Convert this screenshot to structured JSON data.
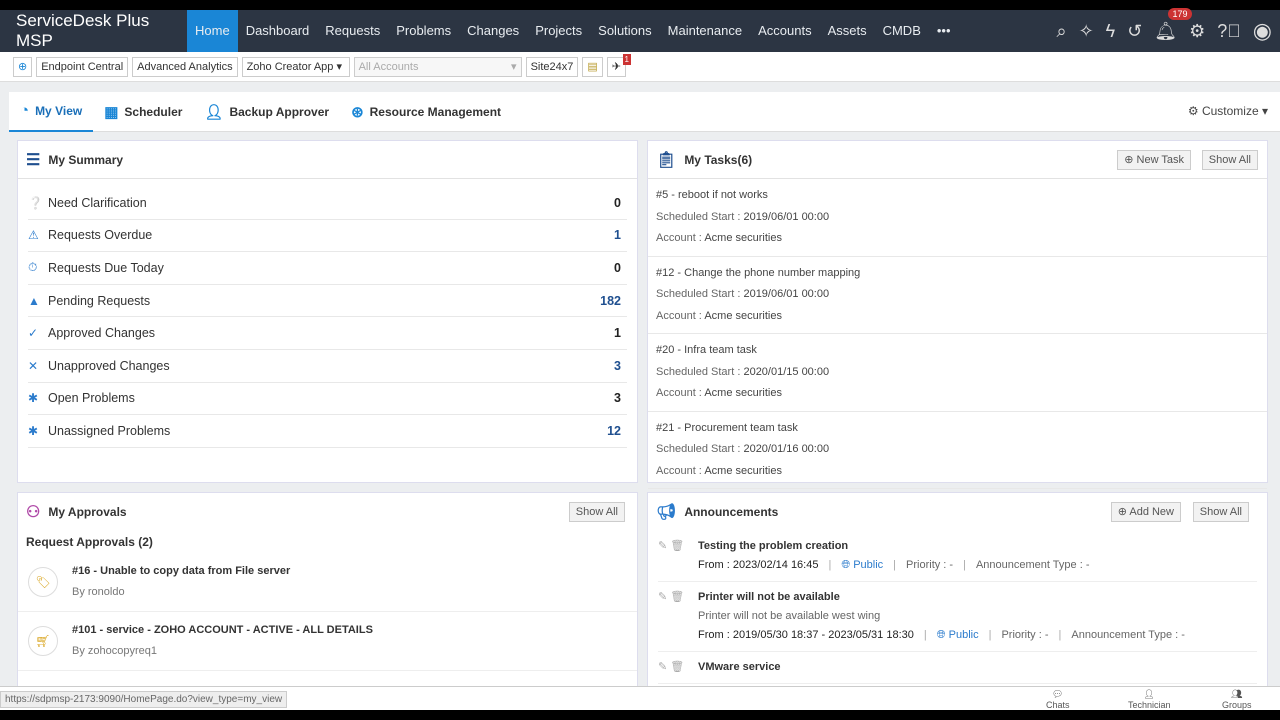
{
  "app": {
    "title": "ServiceDesk Plus MSP"
  },
  "nav": {
    "items": [
      "Home",
      "Dashboard",
      "Requests",
      "Problems",
      "Changes",
      "Projects",
      "Solutions",
      "Maintenance",
      "Accounts",
      "Assets",
      "CMDB"
    ],
    "more": "•••",
    "notif_count": "179"
  },
  "toolbar": {
    "endpoint": "Endpoint Central",
    "analytics": "Advanced Analytics",
    "zoho": "Zoho Creator App",
    "accounts_placeholder": "All Accounts",
    "site": "Site24x7",
    "rocket_badge": "1"
  },
  "tabs": [
    "My View",
    "Scheduler",
    "Backup Approver",
    "Resource Management"
  ],
  "customize": "Customize",
  "summary": {
    "title": "My Summary",
    "rows": [
      {
        "label": "Need Clarification",
        "value": "0"
      },
      {
        "label": "Requests Overdue",
        "value": "1"
      },
      {
        "label": "Requests Due Today",
        "value": "0"
      },
      {
        "label": "Pending Requests",
        "value": "182"
      },
      {
        "label": "Approved Changes",
        "value": "1"
      },
      {
        "label": "Unapproved Changes",
        "value": "3"
      },
      {
        "label": "Open Problems",
        "value": "3"
      },
      {
        "label": "Unassigned Problems",
        "value": "12"
      }
    ]
  },
  "tasks": {
    "title": "My Tasks(6)",
    "new_task": "New Task",
    "show_all": "Show All",
    "sched_label": "Scheduled Start :",
    "account_label": "Account :",
    "items": [
      {
        "title": "#5 - reboot if not works",
        "start": "2019/06/01 00:00",
        "account": "Acme securities"
      },
      {
        "title": "#12 - Change the phone number mapping",
        "start": "2019/06/01 00:00",
        "account": "Acme securities"
      },
      {
        "title": "#20 - Infra team task",
        "start": "2020/01/15 00:00",
        "account": "Acme securities"
      },
      {
        "title": "#21 - Procurement team task",
        "start": "2020/01/16 00:00",
        "account": "Acme securities"
      }
    ]
  },
  "approvals": {
    "title": "My Approvals",
    "show_all": "Show All",
    "subtitle": "Request Approvals (2)",
    "items": [
      {
        "title": "#16 - Unable to copy data from File server",
        "by": "By ronoldo"
      },
      {
        "title": "#101 - service - ZOHO ACCOUNT - ACTIVE - ALL DETAILS",
        "by": "By zohocopyreq1"
      }
    ]
  },
  "announcements": {
    "title": "Announcements",
    "add_new": "Add New",
    "show_all": "Show All",
    "items": [
      {
        "title": "Testing the problem creation",
        "desc": "",
        "from": "From : 2023/02/14 16:45",
        "visibility": "Public",
        "priority": "Priority : -",
        "type": "Announcement Type : -"
      },
      {
        "title": "Printer will not be available",
        "desc": "Printer will not be available west wing",
        "from": "From : 2019/05/30 18:37 -  2023/05/31 18:30",
        "visibility": "Public",
        "priority": "Priority : -",
        "type": "Announcement Type : -"
      },
      {
        "title": "VMware service",
        "desc": "",
        "from": "",
        "visibility": "",
        "priority": "",
        "type": ""
      }
    ]
  },
  "status": {
    "url": "https://sdpmsp-2173:9090/HomePage.do?view_type=my_view",
    "chats": "Chats",
    "technician": "Technician",
    "groups": "Groups"
  }
}
